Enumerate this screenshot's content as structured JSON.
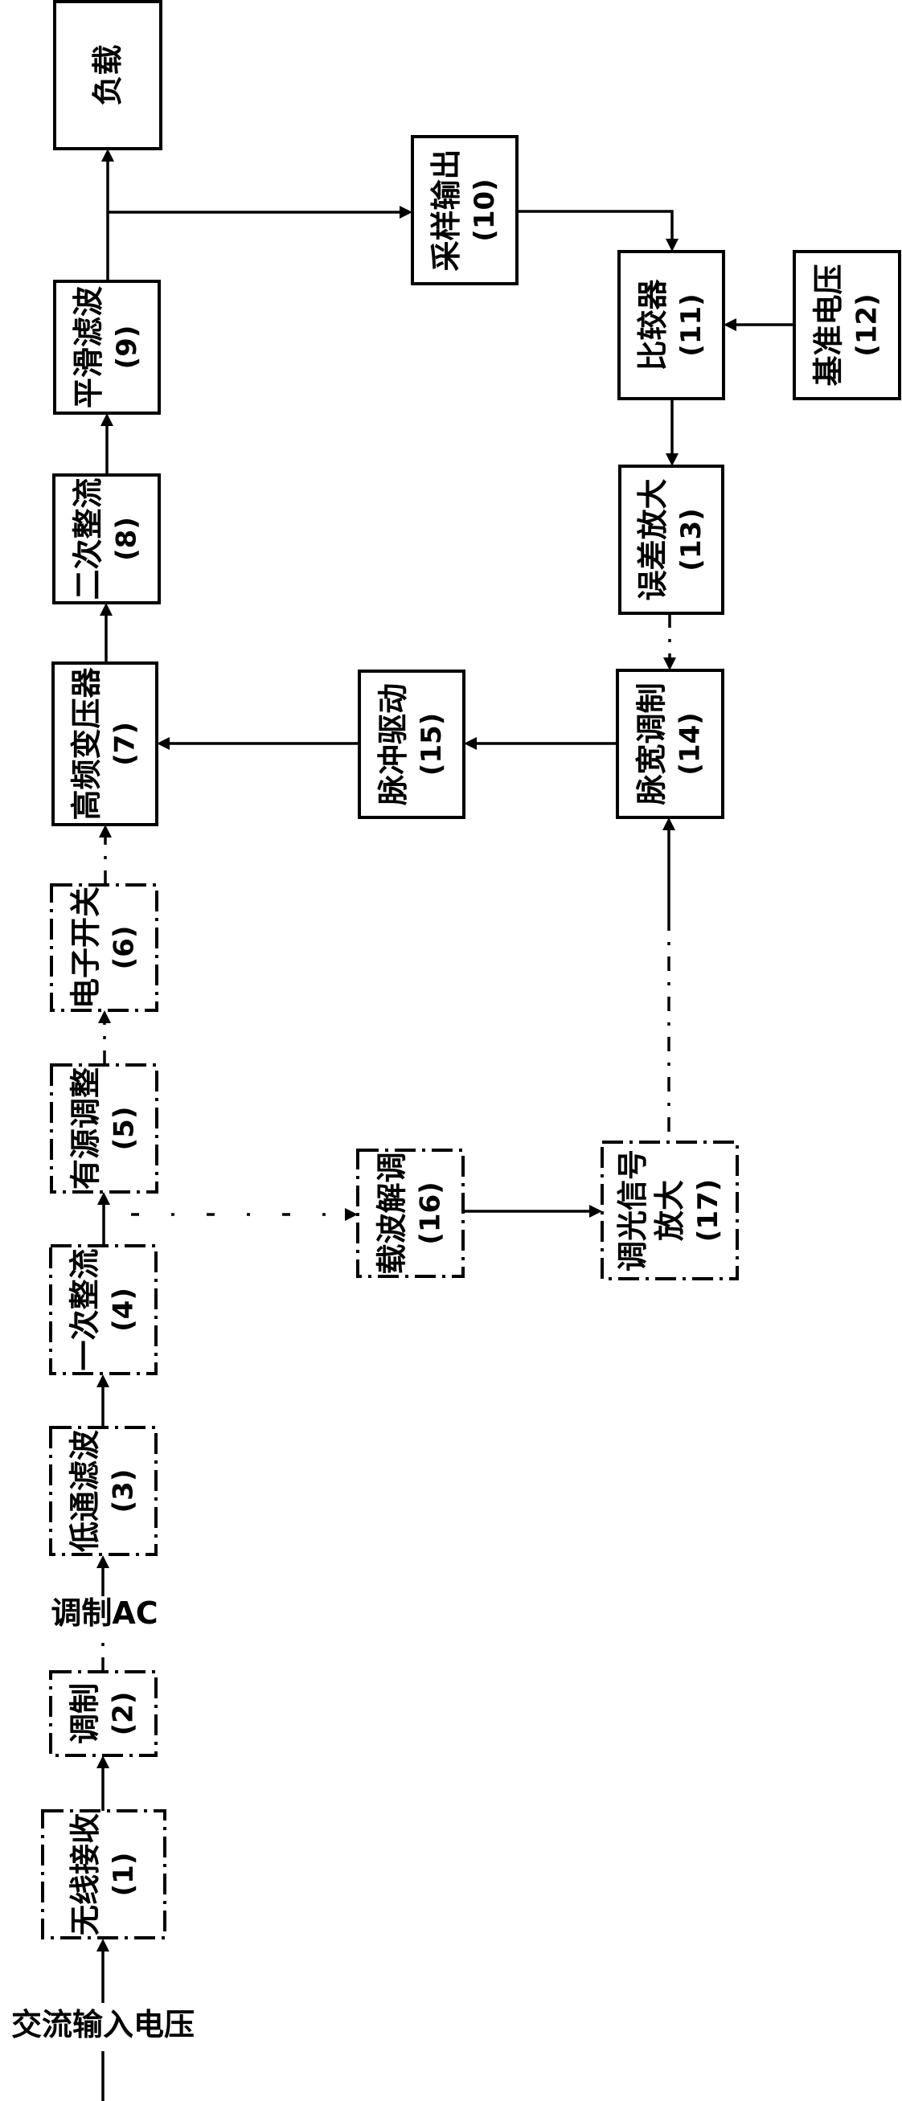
{
  "diagram": {
    "type": "block-diagram",
    "orientation": "rotated-90-ccw",
    "input_label": "交流输入电压",
    "modulated_ac_label": "调制AC",
    "blocks": [
      {
        "id": "load",
        "label": "负载",
        "number": "",
        "border": "solid"
      },
      {
        "id": "b1",
        "label": "无线接收",
        "number": "(1)",
        "border": "dash-dot"
      },
      {
        "id": "b2",
        "label": "调制",
        "number": "(2)",
        "border": "dash-dot"
      },
      {
        "id": "b3",
        "label": "低通滤波",
        "number": "(3)",
        "border": "dash-dot"
      },
      {
        "id": "b4",
        "label": "一次整流",
        "number": "(4)",
        "border": "dash-dot"
      },
      {
        "id": "b5",
        "label": "有源调整",
        "number": "(5)",
        "border": "dash-dot"
      },
      {
        "id": "b6",
        "label": "电子开关",
        "number": "(6)",
        "border": "dash-dot"
      },
      {
        "id": "b7",
        "label": "高频变压器",
        "number": "(7)",
        "border": "solid"
      },
      {
        "id": "b8",
        "label": "二次整流",
        "number": "(8)",
        "border": "solid"
      },
      {
        "id": "b9",
        "label": "平滑滤波",
        "number": "(9)",
        "border": "solid"
      },
      {
        "id": "b10",
        "label": "采样输出",
        "number": "(10)",
        "border": "solid"
      },
      {
        "id": "b11",
        "label": "比较器",
        "number": "(11)",
        "border": "solid"
      },
      {
        "id": "b12",
        "label": "基准电压",
        "number": "(12)",
        "border": "solid"
      },
      {
        "id": "b13",
        "label": "误差放大",
        "number": "(13)",
        "border": "solid"
      },
      {
        "id": "b14",
        "label": "脉宽调制",
        "number": "(14)",
        "border": "solid"
      },
      {
        "id": "b15",
        "label": "脉冲驱动",
        "number": "(15)",
        "border": "solid"
      },
      {
        "id": "b16",
        "label": "载波解调",
        "number": "(16)",
        "border": "dash-dot"
      },
      {
        "id": "b17",
        "label": "调光信号",
        "label2": "放大",
        "number": "(17)",
        "border": "dash-dot"
      }
    ],
    "connections": [
      {
        "from": "input",
        "to": "b1"
      },
      {
        "from": "b1",
        "to": "b2"
      },
      {
        "from": "b2",
        "to": "b3",
        "via_label": "调制AC"
      },
      {
        "from": "b3",
        "to": "b4"
      },
      {
        "from": "b4",
        "to": "b5"
      },
      {
        "from": "b4",
        "to": "b16"
      },
      {
        "from": "b5",
        "to": "b6"
      },
      {
        "from": "b6",
        "to": "b7"
      },
      {
        "from": "b7",
        "to": "b8"
      },
      {
        "from": "b8",
        "to": "b9"
      },
      {
        "from": "b9",
        "to": "load"
      },
      {
        "from": "b9",
        "to": "b10"
      },
      {
        "from": "b10",
        "to": "b11"
      },
      {
        "from": "b12",
        "to": "b11"
      },
      {
        "from": "b11",
        "to": "b13"
      },
      {
        "from": "b13",
        "to": "b14"
      },
      {
        "from": "b14",
        "to": "b15"
      },
      {
        "from": "b15",
        "to": "b7"
      },
      {
        "from": "b16",
        "to": "b17"
      },
      {
        "from": "b17",
        "to": "b14"
      }
    ]
  }
}
